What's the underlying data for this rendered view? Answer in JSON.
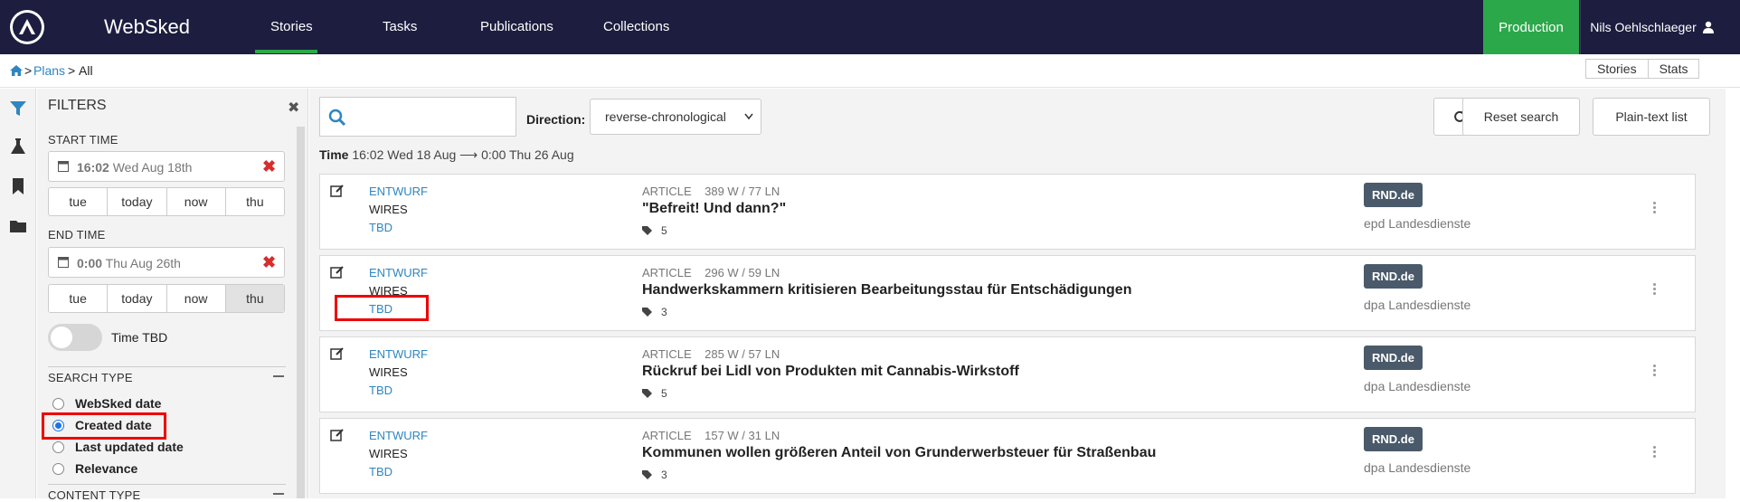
{
  "app": {
    "title": "WebSked"
  },
  "nav": {
    "items": [
      "Stories",
      "Tasks",
      "Publications",
      "Collections"
    ],
    "active": "Stories"
  },
  "header": {
    "production_label": "Production",
    "user_name": "Nils Oehlschlaeger"
  },
  "breadcrumb": {
    "sep": ">",
    "plans": "Plans",
    "current": "All"
  },
  "top_right": {
    "stories": "Stories",
    "stats": "Stats"
  },
  "filters": {
    "title": "FILTERS",
    "start_time": {
      "label": "START TIME",
      "time": "16:02",
      "date": "Wed Aug 18th",
      "buttons": [
        "tue",
        "today",
        "now",
        "thu"
      ]
    },
    "end_time": {
      "label": "END TIME",
      "time": "0:00",
      "date": "Thu Aug 26th",
      "buttons": [
        "tue",
        "today",
        "now",
        "thu"
      ],
      "active": "thu"
    },
    "time_tbd_label": "Time TBD",
    "search_type": {
      "label": "SEARCH TYPE",
      "options": [
        "WebSked date",
        "Created date",
        "Last updated date",
        "Relevance"
      ],
      "selected": "Created date"
    },
    "content_type_label": "CONTENT TYPE"
  },
  "toolbar": {
    "direction_label": "Direction:",
    "direction_value": "reverse-chronological",
    "reset_label": "Reset search",
    "plaintext_label": "Plain-text list"
  },
  "time_range": {
    "label": "Time",
    "text": "16:02 Wed 18 Aug ⟶ 0:00 Thu 26 Aug"
  },
  "stories": [
    {
      "status": "ENTWURF",
      "desk": "WIRES",
      "tbd": "TBD",
      "type": "ARTICLE",
      "count": "389 W / 77 LN",
      "headline": "\"Befreit! Und dann?\"",
      "tags": "5",
      "site": "RND.de",
      "source": "epd Landesdienste"
    },
    {
      "status": "ENTWURF",
      "desk": "WIRES",
      "tbd": "TBD",
      "type": "ARTICLE",
      "count": "296 W / 59 LN",
      "headline": "Handwerkskammern kritisieren Bearbeitungsstau für Entschädigungen",
      "tags": "3",
      "site": "RND.de",
      "source": "dpa Landesdienste"
    },
    {
      "status": "ENTWURF",
      "desk": "WIRES",
      "tbd": "TBD",
      "type": "ARTICLE",
      "count": "285 W / 57 LN",
      "headline": "Rückruf bei Lidl von Produkten mit Cannabis-Wirkstoff",
      "tags": "5",
      "site": "RND.de",
      "source": "dpa Landesdienste"
    },
    {
      "status": "ENTWURF",
      "desk": "WIRES",
      "tbd": "TBD",
      "type": "ARTICLE",
      "count": "157 W / 31 LN",
      "headline": "Kommunen wollen größeren Anteil von Grunderwerbsteuer für Straßenbau",
      "tags": "3",
      "site": "RND.de",
      "source": "dpa Landesdienste"
    }
  ],
  "colors": {
    "topbar": "#1c1d3f",
    "accent": "#2ba84a",
    "link": "#2e86c1",
    "badge": "#4a5a6a",
    "highlight": "#e00000"
  }
}
